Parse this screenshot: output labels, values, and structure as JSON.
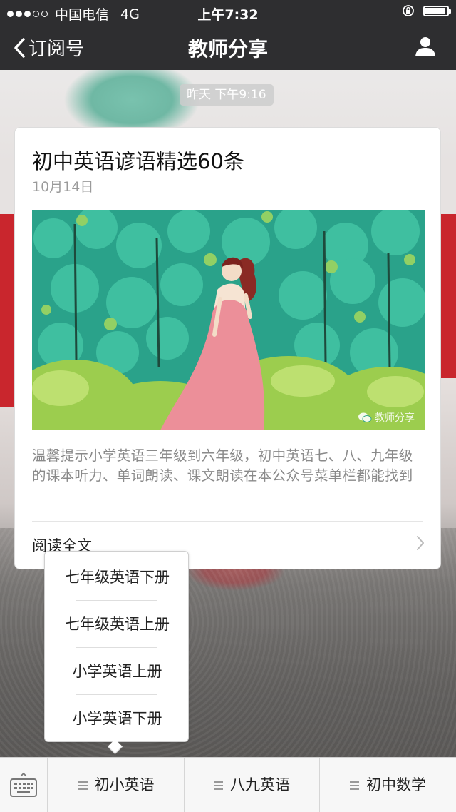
{
  "status_bar": {
    "carrier": "中国电信",
    "network": "4G",
    "time": "上午7:32",
    "battery_level": 0.95
  },
  "nav": {
    "back_label": "订阅号",
    "title": "教师分享"
  },
  "chat": {
    "timestamp": "昨天 下午9:16"
  },
  "article": {
    "title": "初中英语谚语精选60条",
    "date": "10月14日",
    "image_watermark": "教师分享",
    "summary": "温馨提示小学英语三年级到六年级，初中英语七、八、九年级的课本听力、单词朗读、课文朗读在本公众号菜单栏都能找到",
    "read_more": "阅读全文"
  },
  "submenu": {
    "items": [
      "七年级英语下册",
      "七年级英语上册",
      "小学英语上册",
      "小学英语下册"
    ]
  },
  "menu": {
    "tabs": [
      {
        "label": "初小英语"
      },
      {
        "label": "八九英语"
      },
      {
        "label": "初中数学"
      }
    ]
  },
  "colors": {
    "bar_bg": "#2e2e30",
    "card_bg": "#ffffff",
    "muted_text": "#9a9a9a"
  }
}
